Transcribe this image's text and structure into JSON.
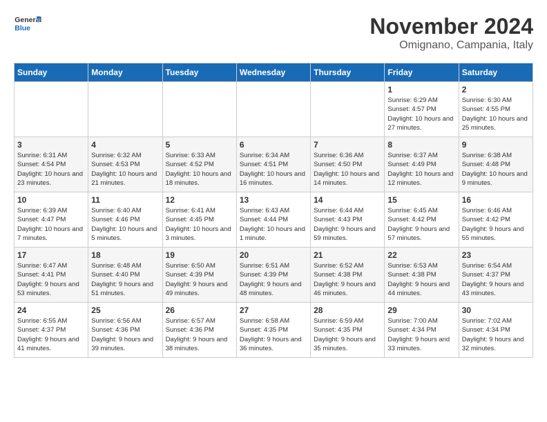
{
  "logo": {
    "line1": "General",
    "line2": "Blue"
  },
  "title": "November 2024",
  "location": "Omignano, Campania, Italy",
  "headers": [
    "Sunday",
    "Monday",
    "Tuesday",
    "Wednesday",
    "Thursday",
    "Friday",
    "Saturday"
  ],
  "weeks": [
    [
      {
        "day": "",
        "info": ""
      },
      {
        "day": "",
        "info": ""
      },
      {
        "day": "",
        "info": ""
      },
      {
        "day": "",
        "info": ""
      },
      {
        "day": "",
        "info": ""
      },
      {
        "day": "1",
        "info": "Sunrise: 6:29 AM\nSunset: 4:57 PM\nDaylight: 10 hours and 27 minutes."
      },
      {
        "day": "2",
        "info": "Sunrise: 6:30 AM\nSunset: 4:55 PM\nDaylight: 10 hours and 25 minutes."
      }
    ],
    [
      {
        "day": "3",
        "info": "Sunrise: 6:31 AM\nSunset: 4:54 PM\nDaylight: 10 hours and 23 minutes."
      },
      {
        "day": "4",
        "info": "Sunrise: 6:32 AM\nSunset: 4:53 PM\nDaylight: 10 hours and 21 minutes."
      },
      {
        "day": "5",
        "info": "Sunrise: 6:33 AM\nSunset: 4:52 PM\nDaylight: 10 hours and 18 minutes."
      },
      {
        "day": "6",
        "info": "Sunrise: 6:34 AM\nSunset: 4:51 PM\nDaylight: 10 hours and 16 minutes."
      },
      {
        "day": "7",
        "info": "Sunrise: 6:36 AM\nSunset: 4:50 PM\nDaylight: 10 hours and 14 minutes."
      },
      {
        "day": "8",
        "info": "Sunrise: 6:37 AM\nSunset: 4:49 PM\nDaylight: 10 hours and 12 minutes."
      },
      {
        "day": "9",
        "info": "Sunrise: 6:38 AM\nSunset: 4:48 PM\nDaylight: 10 hours and 9 minutes."
      }
    ],
    [
      {
        "day": "10",
        "info": "Sunrise: 6:39 AM\nSunset: 4:47 PM\nDaylight: 10 hours and 7 minutes."
      },
      {
        "day": "11",
        "info": "Sunrise: 6:40 AM\nSunset: 4:46 PM\nDaylight: 10 hours and 5 minutes."
      },
      {
        "day": "12",
        "info": "Sunrise: 6:41 AM\nSunset: 4:45 PM\nDaylight: 10 hours and 3 minutes."
      },
      {
        "day": "13",
        "info": "Sunrise: 6:43 AM\nSunset: 4:44 PM\nDaylight: 10 hours and 1 minute."
      },
      {
        "day": "14",
        "info": "Sunrise: 6:44 AM\nSunset: 4:43 PM\nDaylight: 9 hours and 59 minutes."
      },
      {
        "day": "15",
        "info": "Sunrise: 6:45 AM\nSunset: 4:42 PM\nDaylight: 9 hours and 57 minutes."
      },
      {
        "day": "16",
        "info": "Sunrise: 6:46 AM\nSunset: 4:42 PM\nDaylight: 9 hours and 55 minutes."
      }
    ],
    [
      {
        "day": "17",
        "info": "Sunrise: 6:47 AM\nSunset: 4:41 PM\nDaylight: 9 hours and 53 minutes."
      },
      {
        "day": "18",
        "info": "Sunrise: 6:48 AM\nSunset: 4:40 PM\nDaylight: 9 hours and 51 minutes."
      },
      {
        "day": "19",
        "info": "Sunrise: 6:50 AM\nSunset: 4:39 PM\nDaylight: 9 hours and 49 minutes."
      },
      {
        "day": "20",
        "info": "Sunrise: 6:51 AM\nSunset: 4:39 PM\nDaylight: 9 hours and 48 minutes."
      },
      {
        "day": "21",
        "info": "Sunrise: 6:52 AM\nSunset: 4:38 PM\nDaylight: 9 hours and 46 minutes."
      },
      {
        "day": "22",
        "info": "Sunrise: 6:53 AM\nSunset: 4:38 PM\nDaylight: 9 hours and 44 minutes."
      },
      {
        "day": "23",
        "info": "Sunrise: 6:54 AM\nSunset: 4:37 PM\nDaylight: 9 hours and 43 minutes."
      }
    ],
    [
      {
        "day": "24",
        "info": "Sunrise: 6:55 AM\nSunset: 4:37 PM\nDaylight: 9 hours and 41 minutes."
      },
      {
        "day": "25",
        "info": "Sunrise: 6:56 AM\nSunset: 4:36 PM\nDaylight: 9 hours and 39 minutes."
      },
      {
        "day": "26",
        "info": "Sunrise: 6:57 AM\nSunset: 4:36 PM\nDaylight: 9 hours and 38 minutes."
      },
      {
        "day": "27",
        "info": "Sunrise: 6:58 AM\nSunset: 4:35 PM\nDaylight: 9 hours and 36 minutes."
      },
      {
        "day": "28",
        "info": "Sunrise: 6:59 AM\nSunset: 4:35 PM\nDaylight: 9 hours and 35 minutes."
      },
      {
        "day": "29",
        "info": "Sunrise: 7:00 AM\nSunset: 4:34 PM\nDaylight: 9 hours and 33 minutes."
      },
      {
        "day": "30",
        "info": "Sunrise: 7:02 AM\nSunset: 4:34 PM\nDaylight: 9 hours and 32 minutes."
      }
    ]
  ]
}
